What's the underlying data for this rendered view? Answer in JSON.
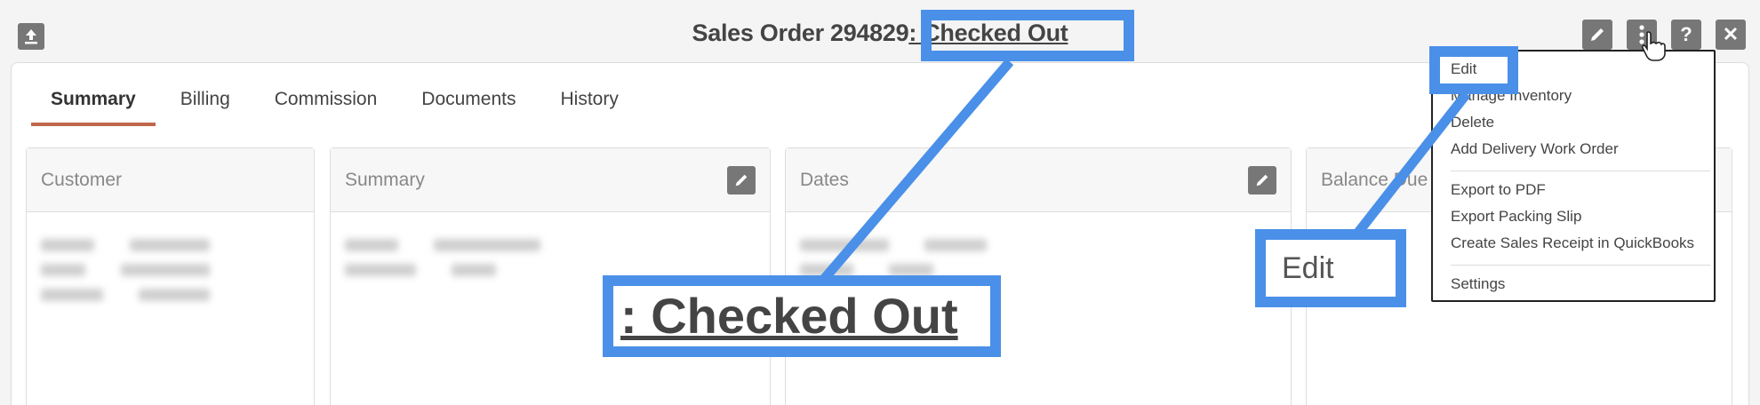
{
  "header": {
    "title_prefix": "Sales Order 294829",
    "status": ": Checked Out"
  },
  "toolbar": {
    "upload_icon": "upload-icon",
    "icons": [
      "pencil-icon",
      "more-vertical-icon",
      "help-icon",
      "close-icon"
    ],
    "help_glyph": "?",
    "close_glyph": "✕"
  },
  "tabs": [
    {
      "label": "Summary",
      "active": true
    },
    {
      "label": "Billing"
    },
    {
      "label": "Commission"
    },
    {
      "label": "Documents"
    },
    {
      "label": "History"
    }
  ],
  "cards": {
    "customer": "Customer",
    "summary": "Summary",
    "dates": "Dates",
    "balance": "Balance Due"
  },
  "menu": {
    "items": [
      "Edit",
      "Manage Inventory",
      "Delete",
      "Add Delivery Work Order",
      "Export to PDF",
      "Export Packing Slip",
      "Create Sales Receipt in QuickBooks",
      "Settings"
    ]
  },
  "callouts": {
    "status_zoom": ": Checked Out",
    "edit_zoom": "Edit"
  },
  "colors": {
    "accent": "#c0674a",
    "highlight": "#4a90e8",
    "icon_bg": "#777777"
  }
}
